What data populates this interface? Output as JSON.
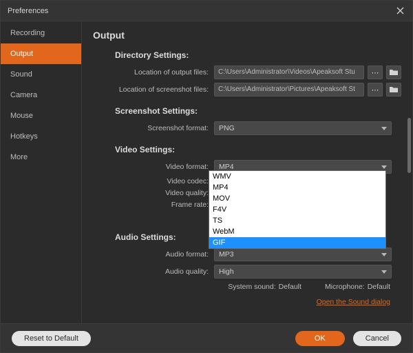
{
  "window": {
    "title": "Preferences"
  },
  "sidebar": {
    "items": [
      {
        "label": "Recording"
      },
      {
        "label": "Output"
      },
      {
        "label": "Sound"
      },
      {
        "label": "Camera"
      },
      {
        "label": "Mouse"
      },
      {
        "label": "Hotkeys"
      },
      {
        "label": "More"
      }
    ],
    "active_index": 1
  },
  "page": {
    "title": "Output",
    "sections": {
      "directory": {
        "heading": "Directory Settings:",
        "output_label": "Location of output files:",
        "output_value": "C:\\Users\\Administrator\\Videos\\Apeaksoft Stu",
        "screenshot_label": "Location of screenshot files:",
        "screenshot_value": "C:\\Users\\Administrator\\Pictures\\Apeaksoft St"
      },
      "screenshot": {
        "heading": "Screenshot Settings:",
        "format_label": "Screenshot format:",
        "format_value": "PNG"
      },
      "video": {
        "heading": "Video Settings:",
        "format_label": "Video format:",
        "format_value": "MP4",
        "codec_label": "Video codec:",
        "quality_label": "Video quality:",
        "framerate_label": "Frame rate:",
        "dropdown_options": [
          "WMV",
          "MP4",
          "MOV",
          "F4V",
          "TS",
          "WebM",
          "GIF"
        ],
        "dropdown_highlight_index": 6
      },
      "audio": {
        "heading": "Audio Settings:",
        "format_label": "Audio format:",
        "format_value": "MP3",
        "quality_label": "Audio quality:",
        "quality_value": "High",
        "system_sound_label": "System sound:",
        "system_sound_value": "Default",
        "microphone_label": "Microphone:",
        "microphone_value": "Default",
        "link": "Open the Sound dialog"
      }
    }
  },
  "footer": {
    "reset": "Reset to Default",
    "ok": "OK",
    "cancel": "Cancel"
  }
}
